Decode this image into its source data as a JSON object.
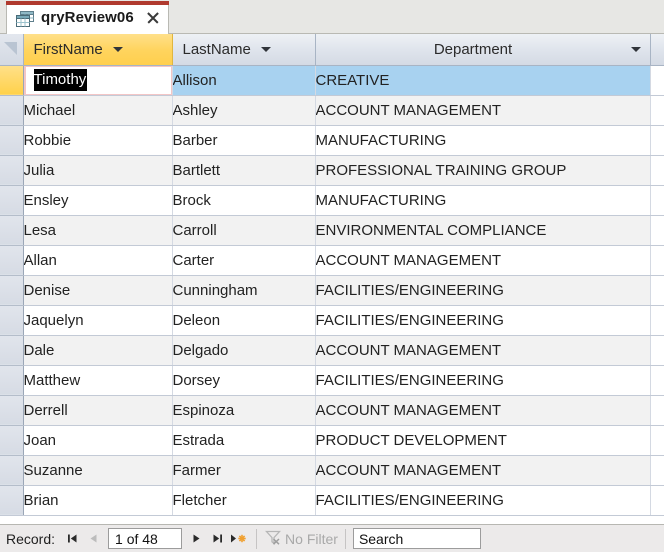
{
  "window": {
    "tab": {
      "label": "qryReview06",
      "icon": "query-datasheet-icon",
      "close_icon": "close-icon",
      "accent_color": "#b03a2e"
    }
  },
  "datasheet": {
    "corner_selector_icon": "select-all-icon",
    "columns": [
      {
        "key": "first_name",
        "label": "FirstName",
        "align": "left",
        "selected": true,
        "dropdown_icon": "chevron-down-icon"
      },
      {
        "key": "last_name",
        "label": "LastName",
        "align": "left",
        "selected": false,
        "dropdown_icon": "chevron-down-icon"
      },
      {
        "key": "department",
        "label": "Department",
        "align": "center",
        "selected": false,
        "dropdown_icon": "chevron-down-icon"
      }
    ],
    "rows": [
      {
        "first_name": "Timothy",
        "last_name": "Allison",
        "department": "CREATIVE"
      },
      {
        "first_name": "Michael",
        "last_name": "Ashley",
        "department": "ACCOUNT MANAGEMENT"
      },
      {
        "first_name": "Robbie",
        "last_name": "Barber",
        "department": "MANUFACTURING"
      },
      {
        "first_name": "Julia",
        "last_name": "Bartlett",
        "department": "PROFESSIONAL TRAINING GROUP"
      },
      {
        "first_name": "Ensley",
        "last_name": "Brock",
        "department": "MANUFACTURING"
      },
      {
        "first_name": "Lesa",
        "last_name": "Carroll",
        "department": "ENVIRONMENTAL COMPLIANCE"
      },
      {
        "first_name": "Allan",
        "last_name": "Carter",
        "department": "ACCOUNT MANAGEMENT"
      },
      {
        "first_name": "Denise",
        "last_name": "Cunningham",
        "department": "FACILITIES/ENGINEERING"
      },
      {
        "first_name": "Jaquelyn",
        "last_name": "Deleon",
        "department": "FACILITIES/ENGINEERING"
      },
      {
        "first_name": "Dale",
        "last_name": "Delgado",
        "department": "ACCOUNT MANAGEMENT"
      },
      {
        "first_name": "Matthew",
        "last_name": "Dorsey",
        "department": "FACILITIES/ENGINEERING"
      },
      {
        "first_name": "Derrell",
        "last_name": "Espinoza",
        "department": "ACCOUNT MANAGEMENT"
      },
      {
        "first_name": "Joan",
        "last_name": "Estrada",
        "department": "PRODUCT DEVELOPMENT"
      },
      {
        "first_name": "Suzanne",
        "last_name": "Farmer",
        "department": "ACCOUNT MANAGEMENT"
      },
      {
        "first_name": "Brian",
        "last_name": "Fletcher",
        "department": "FACILITIES/ENGINEERING"
      }
    ],
    "active_cell": {
      "row_index": 0,
      "column": "first_name",
      "value": "Timothy",
      "editing": true,
      "text_selected": true
    },
    "colors": {
      "selected_row": "#a8d2f0",
      "selected_header": "#ffd45e",
      "alt_row": "#f2f2f2",
      "edit_border": "#f3c6c6"
    }
  },
  "navigation": {
    "record_label": "Record:",
    "first_button": {
      "name": "first-record",
      "icon": "first-record-icon",
      "enabled": false
    },
    "previous_button": {
      "name": "previous-record",
      "icon": "previous-record-icon",
      "enabled": false
    },
    "position": "1 of 48",
    "next_button": {
      "name": "next-record",
      "icon": "next-record-icon",
      "enabled": true
    },
    "last_button": {
      "name": "last-record",
      "icon": "last-record-icon",
      "enabled": true
    },
    "new_button": {
      "name": "new-record",
      "icon": "new-record-icon",
      "enabled": true
    },
    "filter": {
      "label": "No Filter",
      "icon": "filter-funnel-icon",
      "enabled": false
    },
    "search": {
      "value": "Search",
      "placeholder": "Search"
    }
  }
}
